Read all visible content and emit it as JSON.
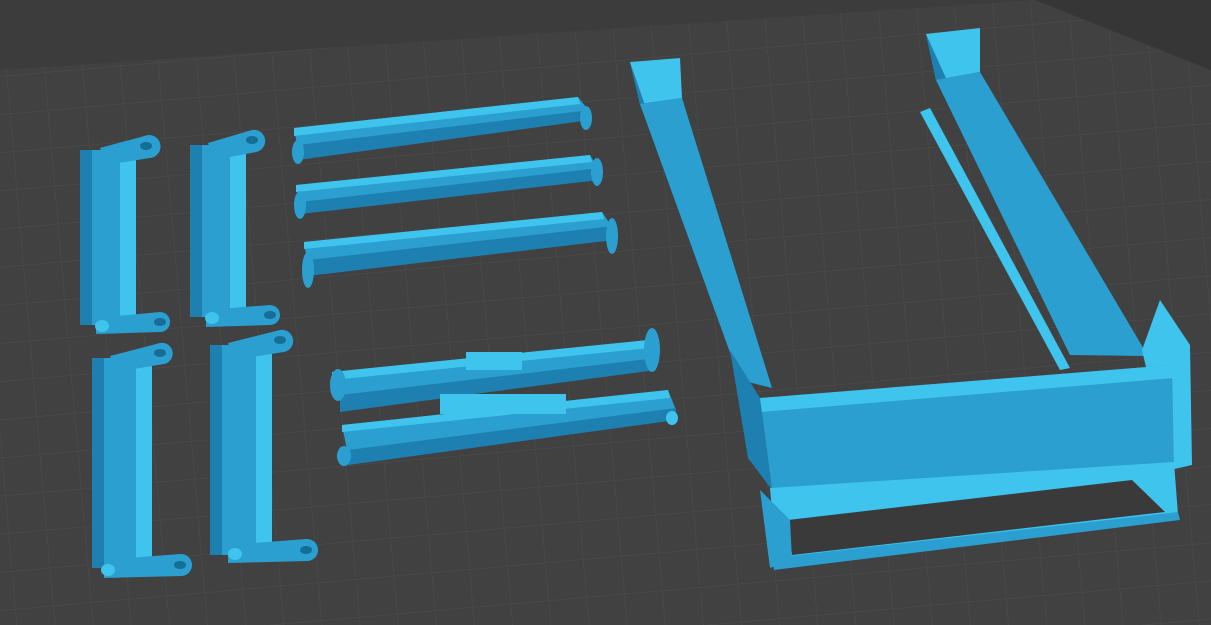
{
  "scene": {
    "view": "3d-print-slicer-build-plate",
    "colors": {
      "background": "#3a3a3a",
      "plate": "#414141",
      "grid": "#4d4d4d",
      "part_light": "#3fc4ee",
      "part_mid": "#2a9fd0",
      "part_dark": "#1d80b0",
      "part_edge": "#166d96"
    },
    "parts": [
      {
        "name": "side-rail-1",
        "type": "rail"
      },
      {
        "name": "side-rail-2",
        "type": "rail"
      },
      {
        "name": "side-rail-3",
        "type": "rail"
      },
      {
        "name": "side-rail-4",
        "type": "rail"
      },
      {
        "name": "crossbar-1",
        "type": "crossbar"
      },
      {
        "name": "crossbar-2",
        "type": "crossbar"
      },
      {
        "name": "crossbar-3",
        "type": "crossbar"
      },
      {
        "name": "double-bar-assembly",
        "type": "double-bar"
      },
      {
        "name": "tray-frame",
        "type": "frame"
      }
    ]
  }
}
